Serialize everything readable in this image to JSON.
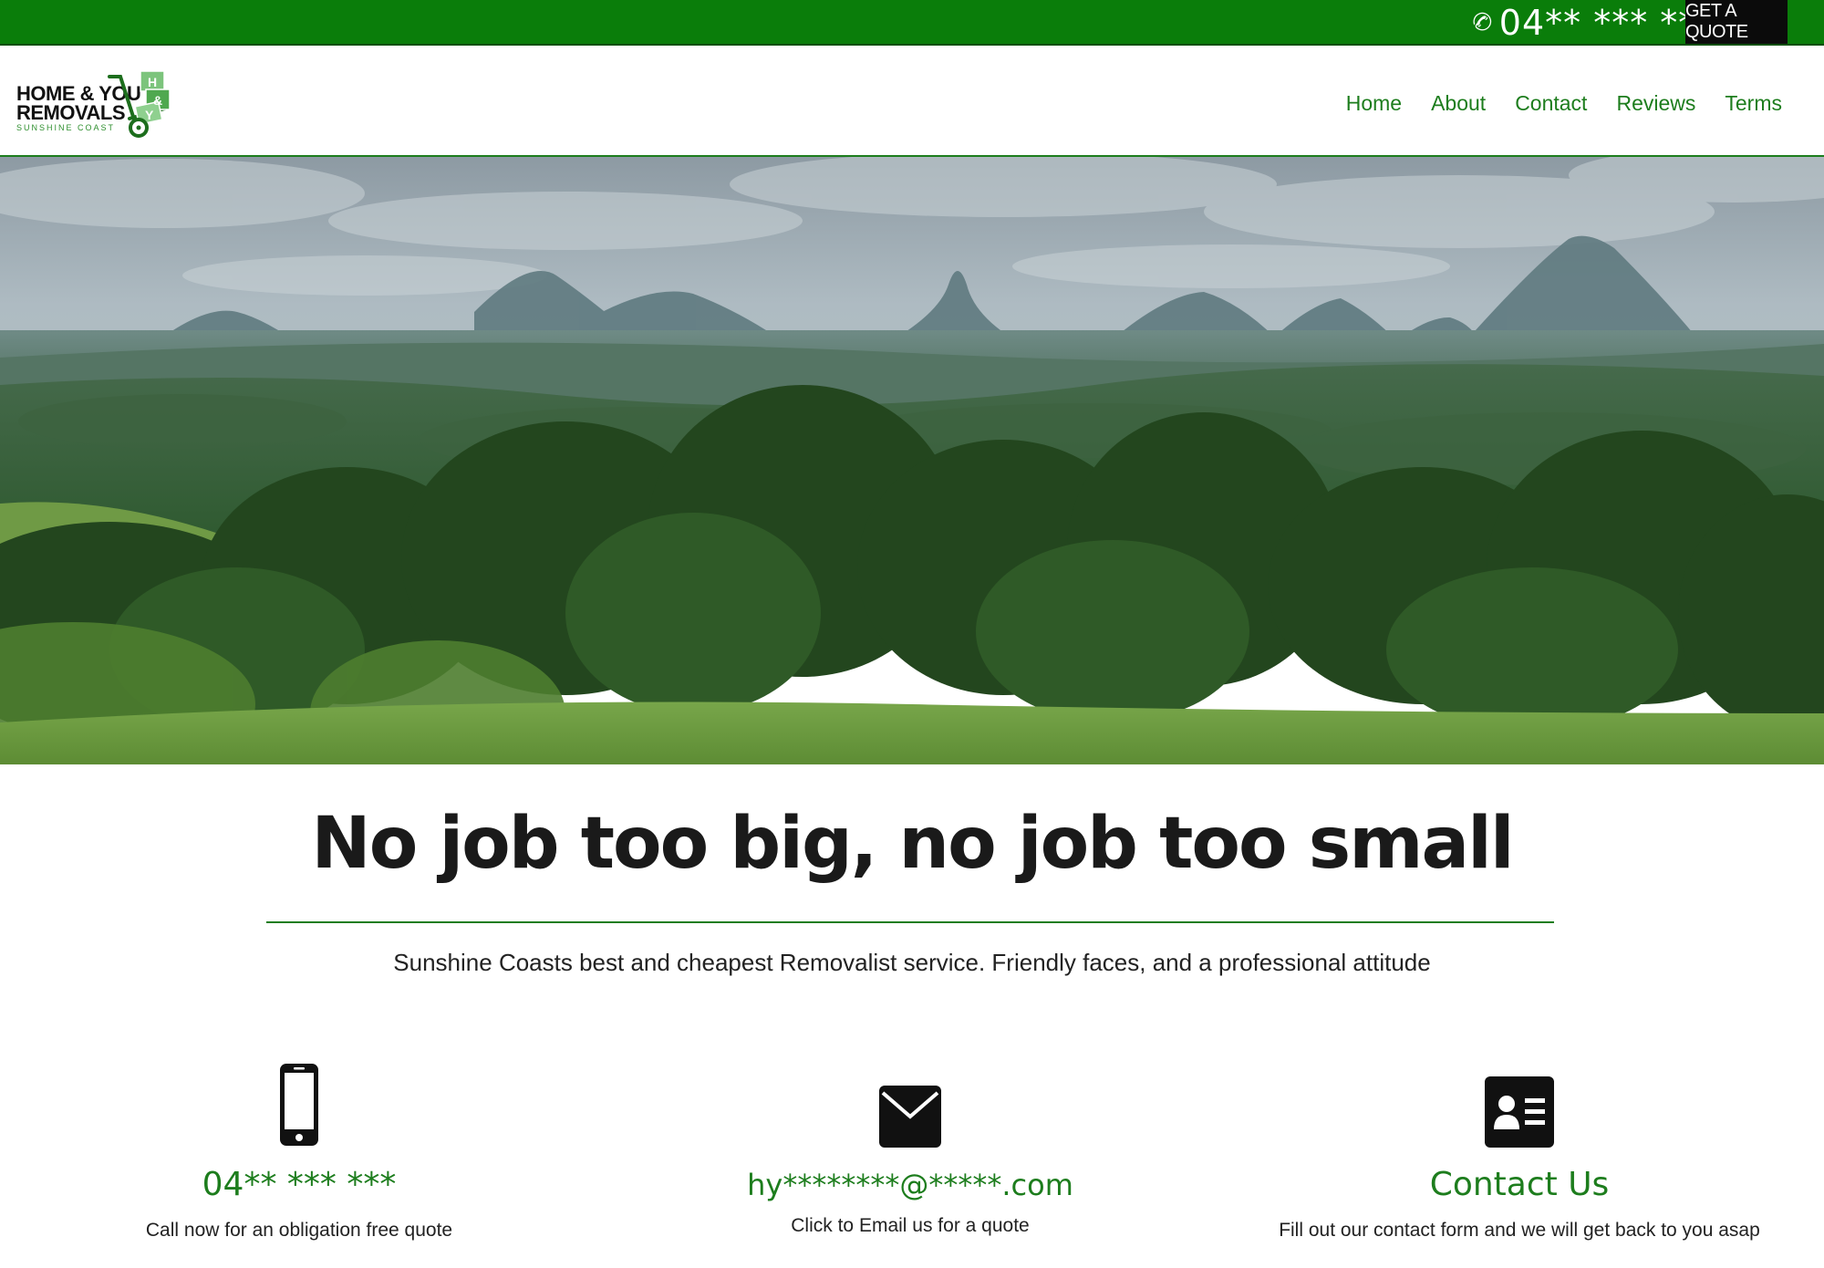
{
  "topbar": {
    "phone_icon": "phone-icon",
    "phone_number": "04** *** ***",
    "quote_label": "GET A QUOTE"
  },
  "logo": {
    "line1": "HOME & YOU",
    "line2": "REMOVALS",
    "line3": "SUNSHINE COAST",
    "badge_letters": [
      "H",
      "&",
      "Y"
    ]
  },
  "nav": {
    "items": [
      "Home",
      "About",
      "Contact",
      "Reviews",
      "Terms"
    ]
  },
  "hero": {
    "image": "landscape photo of hinterland valley with distant volcanic peaks and forest"
  },
  "main": {
    "headline": "No job too big, no job too small",
    "tagline": "Sunshine Coasts best and cheapest Removalist service. Friendly faces, and a professional attitude"
  },
  "features": [
    {
      "icon": "mobile-phone-icon",
      "title": "04** *** ***",
      "description": "Call now for an obligation free quote"
    },
    {
      "icon": "envelope-icon",
      "title": "hy********@*****.com",
      "description": "Click to Email us for a quote"
    },
    {
      "icon": "contact-card-icon",
      "title": "Contact Us",
      "description": "Fill out our contact form and we will get back to you asap"
    }
  ],
  "colors": {
    "brand_green": "#0a7d0a",
    "nav_green": "#1d7d1d",
    "quote_bg": "#0b0b0b",
    "text_dark": "#1a1a1a"
  }
}
